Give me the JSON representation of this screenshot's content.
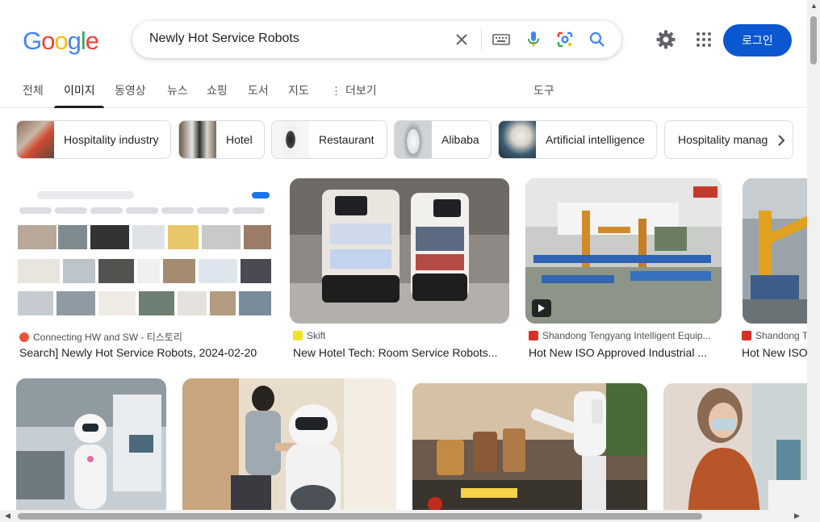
{
  "header": {
    "logo_letters": [
      "G",
      "o",
      "o",
      "g",
      "l",
      "e"
    ],
    "logo_colors": [
      "#4285F4",
      "#EA4335",
      "#FBBC05",
      "#4285F4",
      "#34A853",
      "#EA4335"
    ],
    "query": "Newly Hot Service Robots",
    "login_label": "로그인",
    "icons": [
      "clear-icon",
      "keyboard-icon",
      "voice-search-icon",
      "lens-icon",
      "search-icon",
      "settings-gear-icon",
      "apps-grid-icon"
    ]
  },
  "tabs": {
    "items": [
      "전체",
      "이미지",
      "동영상",
      "뉴스",
      "쇼핑",
      "도서",
      "지도",
      "더보기"
    ],
    "active": "이미지",
    "tools": "도구"
  },
  "chips": [
    {
      "label": "Hospitality industry"
    },
    {
      "label": "Hotel"
    },
    {
      "label": "Restaurant"
    },
    {
      "label": "Alibaba"
    },
    {
      "label": "Artificial intelligence"
    },
    {
      "label": "Hospitality manag"
    }
  ],
  "results_row1": [
    {
      "source": "Connecting HW and SW - 티스토리",
      "title": "Search] Newly Hot Service Robots, 2024-02-20",
      "fav_color": "#e8553d"
    },
    {
      "source": "Skift",
      "title": "New Hotel Tech: Room Service Robots...",
      "fav_color": "#f2e22a"
    },
    {
      "source": "Shandong Tengyang Intelligent Equip...",
      "title": "Hot New ISO Approved Industrial ...",
      "fav_color": "#d93025",
      "video": true
    },
    {
      "source": "Shandong T",
      "title": "Hot New ISO",
      "fav_color": "#d93025"
    }
  ],
  "colors": {
    "accent": "#0b57d0",
    "text_secondary": "#4d5156"
  }
}
